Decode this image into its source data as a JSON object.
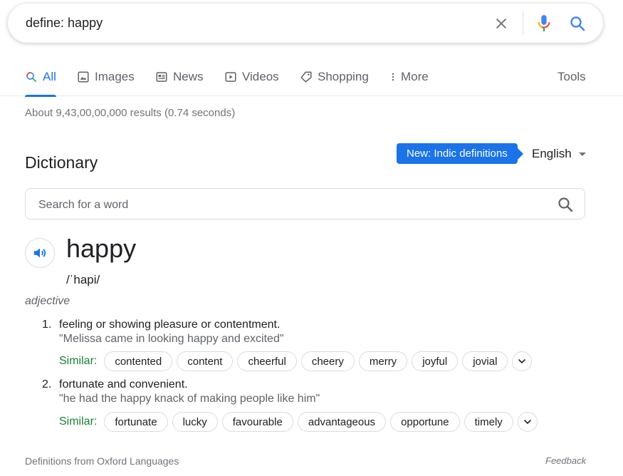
{
  "search": {
    "query": "define: happy"
  },
  "tabs": [
    {
      "label": "All",
      "icon": "search-icon"
    },
    {
      "label": "Images",
      "icon": "image-icon"
    },
    {
      "label": "News",
      "icon": "news-icon"
    },
    {
      "label": "Videos",
      "icon": "video-icon"
    },
    {
      "label": "Shopping",
      "icon": "tag-icon"
    },
    {
      "label": "More",
      "icon": "more-vert-icon"
    }
  ],
  "tools_label": "Tools",
  "stats": "About 9,43,00,00,000 results (0.74 seconds)",
  "dictionary": {
    "title": "Dictionary",
    "badge": "New: Indic definitions",
    "language": "English",
    "word_search_placeholder": "Search for a word",
    "headword": "happy",
    "phonetic": "/ˈhapi/",
    "part_of_speech": "adjective",
    "senses": [
      {
        "number": "1.",
        "definition": "feeling or showing pleasure or contentment.",
        "example": "\"Melissa came in looking happy and excited\"",
        "similar_label": "Similar:",
        "similar": [
          "contented",
          "content",
          "cheerful",
          "cheery",
          "merry",
          "joyful",
          "jovial"
        ]
      },
      {
        "number": "2.",
        "definition": "fortunate and convenient.",
        "example": "\"he had the happy knack of making people like him\"",
        "similar_label": "Similar:",
        "similar": [
          "fortunate",
          "lucky",
          "favourable",
          "advantageous",
          "opportune",
          "timely"
        ]
      }
    ],
    "source": "Definitions from Oxford Languages",
    "feedback": "Feedback"
  },
  "colors": {
    "accent": "#1a73e8",
    "similar_label": "#188038"
  }
}
